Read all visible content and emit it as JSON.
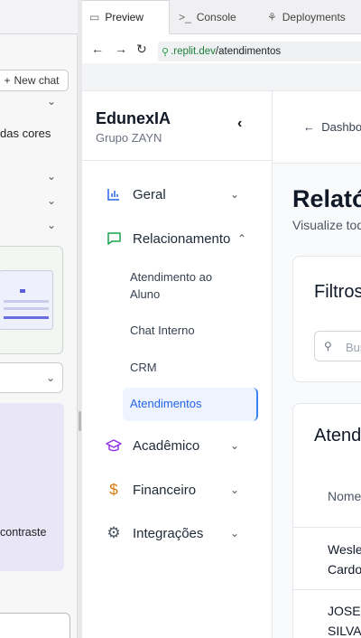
{
  "tabs": [
    {
      "label": "Preview",
      "icon": "monitor-icon"
    },
    {
      "label": "Console",
      "icon": "terminal-icon"
    },
    {
      "label": "Deployments",
      "icon": "deploy-icon"
    }
  ],
  "left_panel": {
    "new_chat_label": "New chat",
    "text_snippet": "das cores",
    "contrast_snippet": "contraste"
  },
  "browser": {
    "url_domain": ".replit.dev",
    "url_path": "/atendimentos"
  },
  "sidebar": {
    "brand": "EdunexIA",
    "subtitle": "Grupo ZAYN",
    "items": [
      {
        "label": "Geral",
        "icon": "bar-chart-icon"
      },
      {
        "label": "Relacionamento",
        "icon": "chat-icon"
      },
      {
        "label": "Acadêmico",
        "icon": "graduation-cap-icon"
      },
      {
        "label": "Financeiro",
        "icon": "dollar-icon"
      },
      {
        "label": "Integrações",
        "icon": "gear-icon"
      }
    ],
    "sub_items": [
      "Atendimento ao Aluno",
      "Chat Interno",
      "CRM",
      "Atendimentos"
    ]
  },
  "main": {
    "back_label": "Dashboard",
    "title": "Relatórios",
    "subtitle": "Visualize todos",
    "filters_title": "Filtros",
    "search_placeholder": "Buscar",
    "table_title": "Atendimentos",
    "column_name": "Nome",
    "rows": [
      {
        "line1": "Wesley",
        "line2": "Cardoso"
      },
      {
        "line1": "JOSE",
        "line2": "SILVA"
      }
    ]
  },
  "colors": {
    "accent": "#2563eb",
    "relacionamento": "#16a34a",
    "academico": "#9333ea",
    "financeiro": "#d97706",
    "geral": "#2563eb"
  }
}
